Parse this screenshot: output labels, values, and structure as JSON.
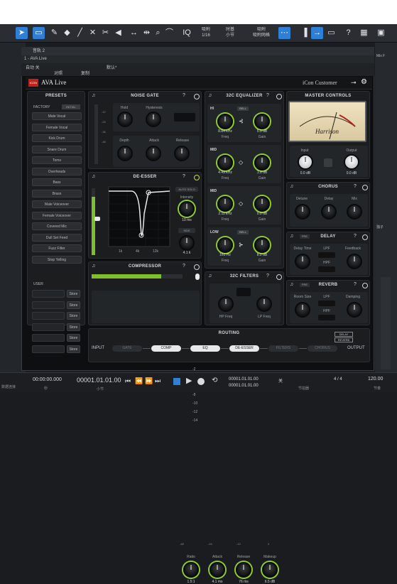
{
  "toolbar": {
    "tools": [
      "select-arrow",
      "range",
      "pencil",
      "eraser",
      "mute",
      "split",
      "listen",
      "bend",
      "zoom",
      "scrub"
    ],
    "iq_label": "IQ",
    "snap_label": "吸附",
    "snap_value": "1/16",
    "timebase_label": "时基",
    "timebase_value": "小节",
    "snap_mode_label": "吸附",
    "snap_mode_value": "吸附网格",
    "help_icon": "?"
  },
  "window": {
    "title": "音轨 2",
    "track_label": "1 - AVA Live",
    "preset_name": "默认*",
    "auto_label": "自动 关",
    "compare_label": "对照",
    "copy_label": "复制",
    "paste_label": "粘贴"
  },
  "plugin": {
    "brand": "AVA Live",
    "logo_text": "ICON",
    "model": "iCon Customer"
  },
  "presets": {
    "title": "PRESETS",
    "factory_label": "FACTORY",
    "init_label": "INITIAL",
    "items": [
      "Male Vocal",
      "Female Vocal",
      "Kick Drum",
      "Snare Drum",
      "Toms",
      "Overheads",
      "Bass",
      "Brass",
      "Male Voiceover",
      "Female Voiceover",
      "Covered Mic",
      "Dull Set Feed",
      "Fuzz Filter",
      "Stop Yelling"
    ],
    "user_label": "USER",
    "store_label": "Store",
    "user_slots": 6
  },
  "noise_gate": {
    "title": "NOISE GATE",
    "hold": "Hold",
    "hysteresis": "Hysteresis",
    "depth": "Depth",
    "attack": "Attack",
    "release": "Release",
    "scale": [
      "-12",
      "-24",
      "-36",
      "-48"
    ]
  },
  "de_esser": {
    "title": "DE-ESSER",
    "auto_solo": "AUTO SOLO",
    "intensity_label": "Intensity",
    "intensity_value": "10 ms",
    "side_label": "SIDE",
    "side_value": "4.1 k",
    "y_ticks": [
      "0",
      "-2",
      "-4",
      "-6",
      "-8",
      "-10",
      "-12",
      "-14"
    ],
    "x_ticks": [
      "1k",
      "4k",
      "12k"
    ]
  },
  "compressor": {
    "title": "COMPRESSOR",
    "scale": [
      "-48",
      "-24",
      "-12",
      "0"
    ],
    "knobs": [
      {
        "label": "Ratio",
        "value": "1.5:1"
      },
      {
        "label": "Attack",
        "value": "4.1 ms"
      },
      {
        "label": "Release",
        "value": "76 ms"
      },
      {
        "label": "Makeup",
        "value": "6.5 dB"
      }
    ]
  },
  "eq": {
    "title": "32C EQUALIZER",
    "bands": [
      {
        "name": "HI",
        "shape": "BELL",
        "freq": "8.84 kHz",
        "gain": "5.5 dB"
      },
      {
        "name": "MID",
        "shape": "",
        "freq": "4.49 kHz",
        "gain": "1.9 dB"
      },
      {
        "name": "MID",
        "shape": "",
        "freq": "2.11 kHz",
        "gain": "0.0 dB"
      },
      {
        "name": "LOW",
        "shape": "BELL",
        "freq": "161 Hz",
        "gain": "8.2 dB"
      }
    ],
    "freq_label": "Freq",
    "gain_label": "Gain"
  },
  "filters": {
    "title": "32C FILTERS",
    "hp": "HP Freq",
    "lp": "LP Freq"
  },
  "master": {
    "title": "MASTER CONTROLS",
    "vu_brand": "Harrison",
    "input_label": "Input",
    "input_value": "0.0 dB",
    "output_label": "Output",
    "output_value": "0.0 dB"
  },
  "chorus": {
    "title": "CHORUS",
    "detune": "Detune",
    "delay": "Delay",
    "mix": "Mix"
  },
  "delay": {
    "title": "DELAY",
    "pre": "PRE",
    "delay_time": "Delay Time",
    "lpf": "LPF",
    "hpf": "HPF",
    "feedback": "Feedback"
  },
  "reverb": {
    "title": "REVERB",
    "pre": "PRE",
    "room_size": "Room Size",
    "lpf": "LPF",
    "hpf": "HPF",
    "damping": "Damping"
  },
  "routing": {
    "title": "ROUTING",
    "input": "INPUT",
    "output": "OUTPUT",
    "chain": [
      {
        "label": "GATE",
        "on": false
      },
      {
        "label": "COMP",
        "on": true
      },
      {
        "label": "EQ",
        "on": true
      },
      {
        "label": "DE-ESSER",
        "on": true
      },
      {
        "label": "FILTERS",
        "on": false
      },
      {
        "label": "CHORUS",
        "on": false
      }
    ],
    "delay_btn": "DELAY",
    "reverb_btn": "REVERB"
  },
  "right_strip": {
    "label1": "Mix F",
    "label2": "独子"
  },
  "transport": {
    "time_primary": "00:00:00.000",
    "time_label": "秒",
    "position": "00001.01.01.00",
    "position_label": "小节",
    "loop_start": "00001.01.01.00",
    "loop_end": "00001.01.01.00",
    "sync": "关",
    "metronome": "节拍器",
    "timesig": "4 / 4",
    "tempo": "120.00",
    "tempo_label": "节奏",
    "footer_left": "数据连接",
    "footer_right": "Clip"
  },
  "colors": {
    "accent": "#2f7fd6",
    "knob_ring": "#8fcf2b",
    "meter": "#7fc02a"
  }
}
